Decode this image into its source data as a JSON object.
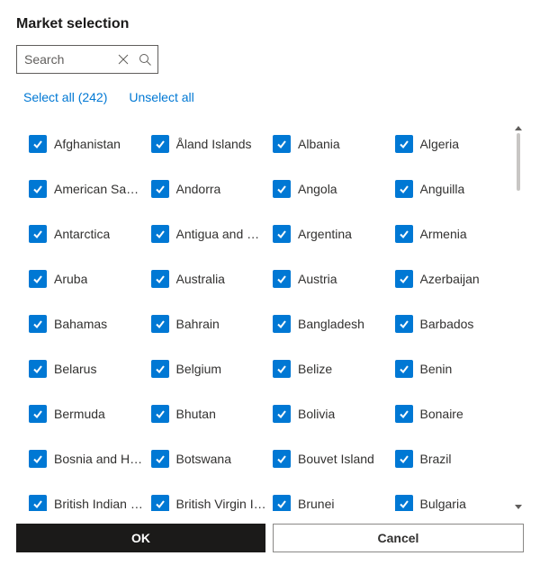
{
  "title": "Market selection",
  "search": {
    "placeholder": "Search",
    "value": ""
  },
  "total_count": 242,
  "links": {
    "select_all": "Select all (242)",
    "unselect_all": "Unselect all"
  },
  "markets": [
    {
      "label": "Afghanistan",
      "checked": true
    },
    {
      "label": "Åland Islands",
      "checked": true
    },
    {
      "label": "Albania",
      "checked": true
    },
    {
      "label": "Algeria",
      "checked": true
    },
    {
      "label": "American Samoa",
      "checked": true
    },
    {
      "label": "Andorra",
      "checked": true
    },
    {
      "label": "Angola",
      "checked": true
    },
    {
      "label": "Anguilla",
      "checked": true
    },
    {
      "label": "Antarctica",
      "checked": true
    },
    {
      "label": "Antigua and Barbuda",
      "checked": true
    },
    {
      "label": "Argentina",
      "checked": true
    },
    {
      "label": "Armenia",
      "checked": true
    },
    {
      "label": "Aruba",
      "checked": true
    },
    {
      "label": "Australia",
      "checked": true
    },
    {
      "label": "Austria",
      "checked": true
    },
    {
      "label": "Azerbaijan",
      "checked": true
    },
    {
      "label": "Bahamas",
      "checked": true
    },
    {
      "label": "Bahrain",
      "checked": true
    },
    {
      "label": "Bangladesh",
      "checked": true
    },
    {
      "label": "Barbados",
      "checked": true
    },
    {
      "label": "Belarus",
      "checked": true
    },
    {
      "label": "Belgium",
      "checked": true
    },
    {
      "label": "Belize",
      "checked": true
    },
    {
      "label": "Benin",
      "checked": true
    },
    {
      "label": "Bermuda",
      "checked": true
    },
    {
      "label": "Bhutan",
      "checked": true
    },
    {
      "label": "Bolivia",
      "checked": true
    },
    {
      "label": "Bonaire",
      "checked": true
    },
    {
      "label": "Bosnia and Herzegovina",
      "checked": true
    },
    {
      "label": "Botswana",
      "checked": true
    },
    {
      "label": "Bouvet Island",
      "checked": true
    },
    {
      "label": "Brazil",
      "checked": true
    },
    {
      "label": "British Indian Ocean Territory",
      "checked": true
    },
    {
      "label": "British Virgin Islands",
      "checked": true
    },
    {
      "label": "Brunei",
      "checked": true
    },
    {
      "label": "Bulgaria",
      "checked": true
    }
  ],
  "buttons": {
    "ok": "OK",
    "cancel": "Cancel"
  },
  "colors": {
    "accent": "#0078d4",
    "text": "#323130",
    "border": "#605e5c"
  }
}
